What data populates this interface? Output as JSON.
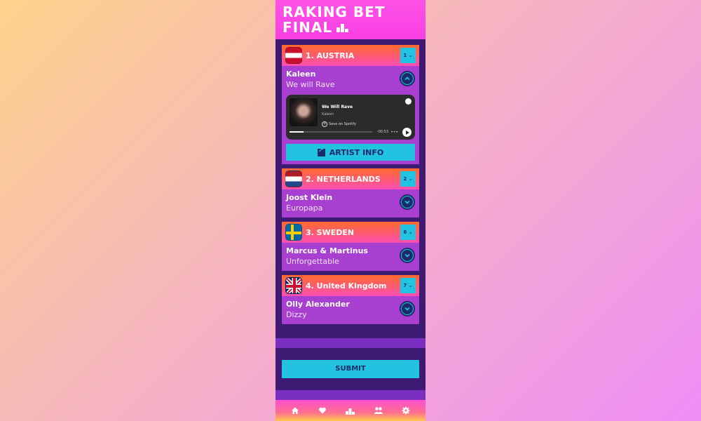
{
  "app": {
    "title_line1": "RAKING BET",
    "title_line2": "FINAL"
  },
  "entries": [
    {
      "rank_label": "1. AUSTRIA",
      "artist": "Kaleen",
      "song": "We will Rave",
      "vote": "1",
      "expanded": true,
      "flag": "austria-flag"
    },
    {
      "rank_label": "2. NETHERLANDS",
      "artist": "Joost Klein",
      "song": "Europapa",
      "vote": "2",
      "expanded": false,
      "flag": "netherlands-flag"
    },
    {
      "rank_label": "3. SWEDEN",
      "artist": "Marcus & Martinus",
      "song": "Unforgettable",
      "vote": "6",
      "expanded": false,
      "flag": "sweden-flag"
    },
    {
      "rank_label": "4. United Kingdom",
      "artist": "Olly Alexander",
      "song": "Dizzy",
      "vote": "7",
      "expanded": false,
      "flag": "uk-flag"
    }
  ],
  "player": {
    "track_title": "We Will Rave",
    "track_artist": "Kaleen",
    "save_label": "Save on Spotify",
    "time": "-00:53",
    "progress": 0.17
  },
  "artist_info_label": "ARTIST INFO",
  "submit_label": "SUBMIT",
  "nav": [
    "home-icon",
    "heart-icon",
    "podium-icon",
    "users-icon",
    "gear-icon"
  ],
  "colors": {
    "accent": "#22c3e0",
    "panel": "#3f1a73",
    "card": "#a93fd0",
    "header": "#ff52e8"
  }
}
